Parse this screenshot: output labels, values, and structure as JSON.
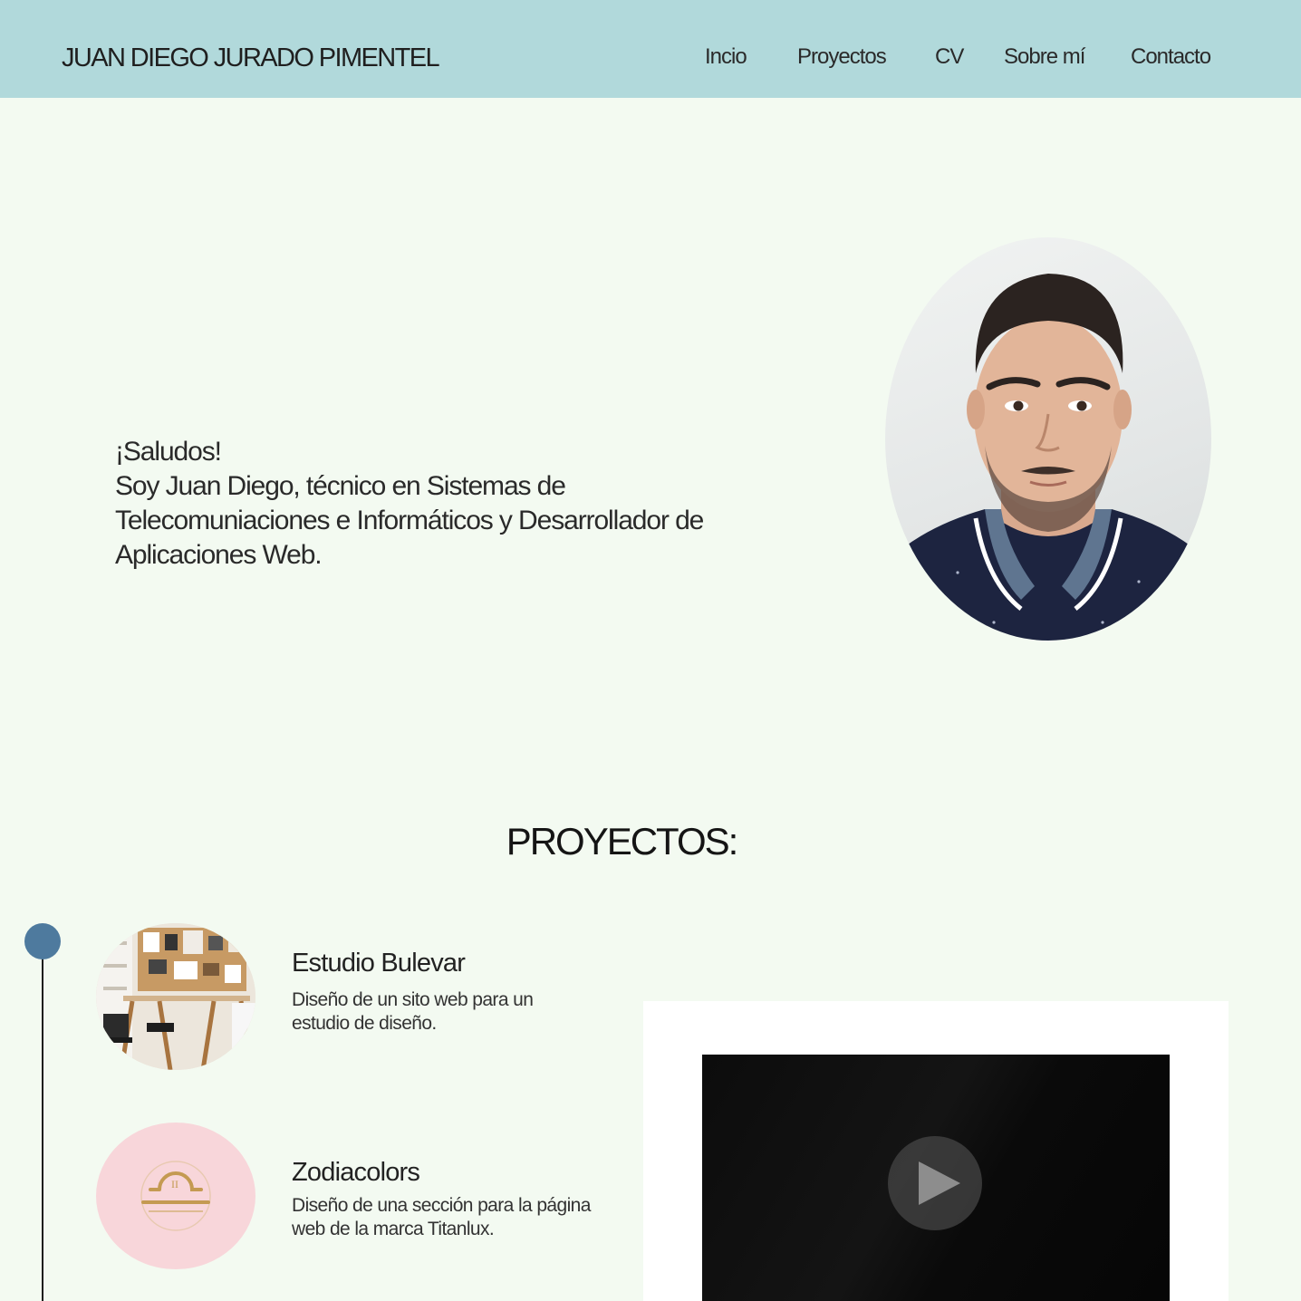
{
  "header": {
    "site_title": "JUAN DIEGO JURADO PIMENTEL",
    "nav": [
      "Incio",
      "Proyectos",
      "CV",
      "Sobre mí",
      "Contacto"
    ]
  },
  "hero": {
    "intro_lines": [
      "¡Saludos!",
      "Soy Juan Diego, técnico en Sistemas de",
      "Telecomuniaciones e Informáticos y Desarrollador de",
      "Aplicaciones Web."
    ]
  },
  "projects": {
    "section_title": "PROYECTOS:",
    "items": [
      {
        "name": "Estudio Bulevar",
        "description_lines": [
          "Diseño de un sito web para un",
          "estudio de diseño."
        ]
      },
      {
        "name": "Zodiacolors",
        "description_lines": [
          "Diseño de una sección para la página",
          "web de la marca Titanlux."
        ]
      }
    ]
  },
  "colors": {
    "header_bg": "#b1d9db",
    "page_bg": "#f3faf1",
    "timeline_dot": "#4e7a9e",
    "zodiac_bg": "#f8d6da"
  },
  "icons": {
    "play": "play-icon",
    "zodiac": "libra-zodiac-icon"
  }
}
